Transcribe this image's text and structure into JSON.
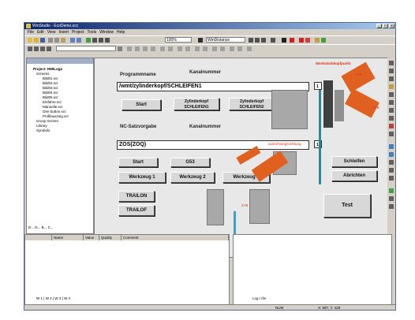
{
  "window": {
    "title": "WinStudio - EcoDemo.scc"
  },
  "menu": [
    "File",
    "Edit",
    "View",
    "Insert",
    "Project",
    "Tools",
    "Window",
    "Help"
  ],
  "toolbar": {
    "zoom": "100%",
    "font_field": "WinDistance"
  },
  "project_tree": {
    "title": "Project: HMILogo",
    "items": [
      "Screens",
      "Bild01.scr",
      "Bild02.scr",
      "Bild03.scr",
      "Bild04.scr",
      "Bild05.scr",
      "Einfahre.scr",
      "Manuelle.scr",
      "One button.scr",
      "Profilauszeig.scr",
      "Group Screen",
      "Library",
      "Symbols"
    ]
  },
  "tree_tabs": [
    "D...",
    "N...",
    "B...",
    "C..."
  ],
  "screen": {
    "programmname_label": "Programmname",
    "kanalnummer_label_1": "Kanalnummer",
    "program_value": "/wmt/zylinderkopf/SCHLEIFEN1",
    "channel_value_1": "1",
    "start_label": "Start",
    "zylinderkopf_1": "Zylinderkopf SCHLEIFEN1",
    "zylinderkopf_2": "Zylinderkopf SCHLEIFEN2",
    "nc_label": "NC-Satzvorgabe",
    "kanalnummer_label_2": "Kanalnummer",
    "nc_value": "ZOS(ZOQ)",
    "channel_value_2": "1",
    "start_label_2": "Start",
    "g53_label": "G53",
    "werkzeug1": "Werkzeug 1",
    "werkzeug2": "Werkzeug 2",
    "werkzeug3": "Werkzeug 3",
    "trailon": "TRAILON",
    "trailof": "TRAILOF",
    "schleifen": "Schleifen",
    "abrichten": "Abrichten",
    "test": "Test",
    "werkzeug_label": "Werkstückkopfpunkt",
    "z_label": "Z+B",
    "x_label": "X+B",
    "z_label_2": "Z+B",
    "ausrichtung_label": "ausrichtungsrichtung"
  },
  "table": {
    "columns": [
      "Name",
      "Value",
      "Quality",
      "Comment"
    ]
  },
  "table_tabs": [
    "W 1",
    "W 2",
    "W 3",
    "W 4"
  ],
  "log_tabs": [
    "Log",
    "Ifw"
  ],
  "status": {
    "mode": "NUM",
    "coords": "X: 987, Y: 428"
  }
}
